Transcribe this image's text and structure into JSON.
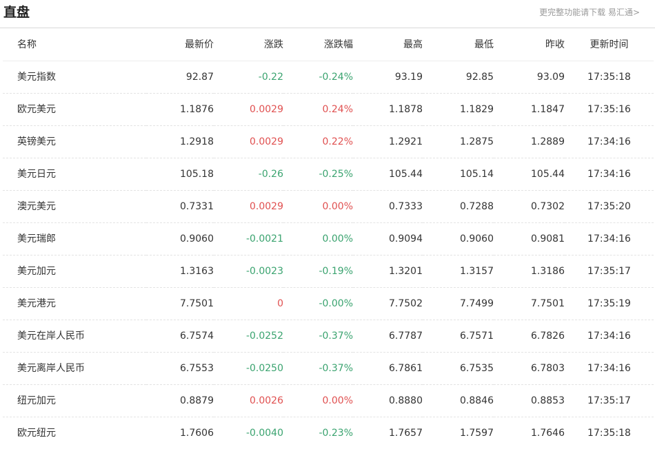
{
  "header": {
    "title": "直盘",
    "more_link": "更完整功能请下载 易汇通>"
  },
  "table": {
    "columns": [
      "名称",
      "最新价",
      "涨跌",
      "涨跌幅",
      "最高",
      "最低",
      "昨收",
      "更新时间"
    ],
    "rows": [
      {
        "name": "美元指数",
        "last": "92.87",
        "change": "-0.22",
        "change_pct": "-0.24%",
        "high": "93.19",
        "low": "92.85",
        "prev_close": "93.09",
        "time": "17:35:18",
        "trend": "down"
      },
      {
        "name": "欧元美元",
        "last": "1.1876",
        "change": "0.0029",
        "change_pct": "0.24%",
        "high": "1.1878",
        "low": "1.1829",
        "prev_close": "1.1847",
        "time": "17:35:16",
        "trend": "up"
      },
      {
        "name": "英镑美元",
        "last": "1.2918",
        "change": "0.0029",
        "change_pct": "0.22%",
        "high": "1.2921",
        "low": "1.2875",
        "prev_close": "1.2889",
        "time": "17:34:16",
        "trend": "up"
      },
      {
        "name": "美元日元",
        "last": "105.18",
        "change": "-0.26",
        "change_pct": "-0.25%",
        "high": "105.44",
        "low": "105.14",
        "prev_close": "105.44",
        "time": "17:34:16",
        "trend": "down"
      },
      {
        "name": "澳元美元",
        "last": "0.7331",
        "change": "0.0029",
        "change_pct": "0.00%",
        "high": "0.7333",
        "low": "0.7288",
        "prev_close": "0.7302",
        "time": "17:35:20",
        "trend": "up"
      },
      {
        "name": "美元瑞郎",
        "last": "0.9060",
        "change": "-0.0021",
        "change_pct": "0.00%",
        "high": "0.9094",
        "low": "0.9060",
        "prev_close": "0.9081",
        "time": "17:34:16",
        "trend": "down"
      },
      {
        "name": "美元加元",
        "last": "1.3163",
        "change": "-0.0023",
        "change_pct": "-0.19%",
        "high": "1.3201",
        "low": "1.3157",
        "prev_close": "1.3186",
        "time": "17:35:17",
        "trend": "down"
      },
      {
        "name": "美元港元",
        "last": "7.7501",
        "change": "0",
        "change_pct": "-0.00%",
        "high": "7.7502",
        "low": "7.7499",
        "prev_close": "7.7501",
        "time": "17:35:19",
        "trend": "up",
        "pct_trend": "down"
      },
      {
        "name": "美元在岸人民币",
        "last": "6.7574",
        "change": "-0.0252",
        "change_pct": "-0.37%",
        "high": "6.7787",
        "low": "6.7571",
        "prev_close": "6.7826",
        "time": "17:34:16",
        "trend": "down"
      },
      {
        "name": "美元离岸人民币",
        "last": "6.7553",
        "change": "-0.0250",
        "change_pct": "-0.37%",
        "high": "6.7861",
        "low": "6.7535",
        "prev_close": "6.7803",
        "time": "17:34:16",
        "trend": "down"
      },
      {
        "name": "纽元加元",
        "last": "0.8879",
        "change": "0.0026",
        "change_pct": "0.00%",
        "high": "0.8880",
        "low": "0.8846",
        "prev_close": "0.8853",
        "time": "17:35:17",
        "trend": "up"
      },
      {
        "name": "欧元纽元",
        "last": "1.7606",
        "change": "-0.0040",
        "change_pct": "-0.23%",
        "high": "1.7657",
        "low": "1.7597",
        "prev_close": "1.7646",
        "time": "17:35:18",
        "trend": "down"
      }
    ]
  },
  "colors": {
    "up": "#e05050",
    "down": "#3aa36f",
    "text": "#333333",
    "muted": "#9a9a9a"
  }
}
